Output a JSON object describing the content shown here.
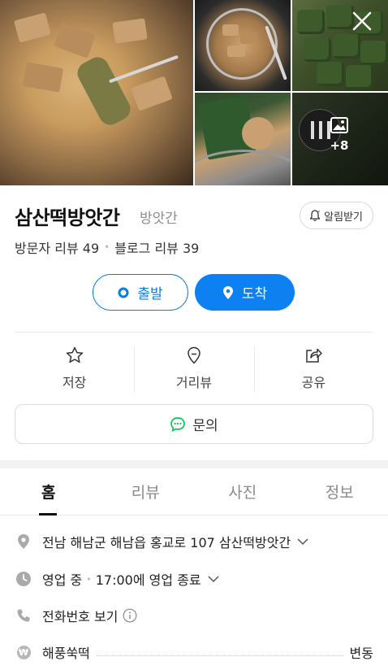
{
  "gallery": {
    "more_photos_count": "+8",
    "close_icon": "close-icon",
    "photo_icon": "image-icon"
  },
  "place": {
    "name": "삼산떡방앗간",
    "category": "방앗간",
    "notify_label": "알림받기",
    "visitor_reviews": "방문자 리뷰 49",
    "blog_reviews": "블로그 리뷰 39"
  },
  "route": {
    "start_label": "출발",
    "arrive_label": "도착"
  },
  "actions": [
    {
      "label": "저장",
      "icon": "star-icon"
    },
    {
      "label": "거리뷰",
      "icon": "location-pin-icon"
    },
    {
      "label": "공유",
      "icon": "share-icon"
    }
  ],
  "inquiry": {
    "label": "문의",
    "icon": "chat-icon"
  },
  "tabs": [
    {
      "label": "홈",
      "active": true
    },
    {
      "label": "리뷰",
      "active": false
    },
    {
      "label": "사진",
      "active": false
    },
    {
      "label": "정보",
      "active": false
    }
  ],
  "info": {
    "address": "전남 해남군 해남읍 홍교로 107 삼산떡방앗간",
    "status": "영업 중",
    "hours": "17:00에 영업 종료",
    "phone": "전화번호 보기",
    "menu_name": "해풍쑥떡",
    "menu_price": "변동",
    "currency_symbol": "₩"
  },
  "colors": {
    "accent": "#0d80f2",
    "chat_green": "#03c75a"
  }
}
